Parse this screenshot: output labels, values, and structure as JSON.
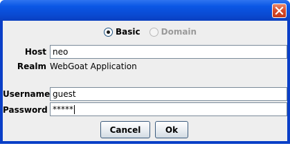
{
  "dialog": {
    "close_icon": "close-icon"
  },
  "auth": {
    "options": [
      {
        "label": "Basic",
        "selected": true,
        "enabled": true
      },
      {
        "label": "Domain",
        "selected": false,
        "enabled": false
      }
    ]
  },
  "form": {
    "host_label": "Host",
    "host_value": "neo",
    "realm_label": "Realm",
    "realm_value": "WebGoat Application",
    "username_label": "Username",
    "username_value": "guest",
    "password_label": "Password",
    "password_value": "*****"
  },
  "buttons": {
    "cancel": "Cancel",
    "ok": "Ok"
  }
}
